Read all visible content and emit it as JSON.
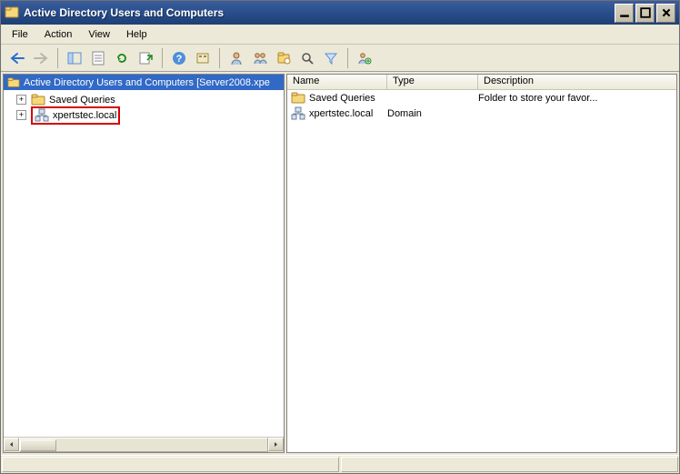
{
  "window": {
    "title": "Active Directory Users and Computers"
  },
  "menubar": {
    "file": "File",
    "action": "Action",
    "view": "View",
    "help": "Help"
  },
  "tree": {
    "root_label": "Active Directory Users and Computers [Server2008.xpe",
    "items": [
      {
        "label": "Saved Queries",
        "icon": "folder"
      },
      {
        "label": "xpertstec.local",
        "icon": "domain",
        "highlight": true
      }
    ]
  },
  "list": {
    "columns": {
      "name": "Name",
      "type": "Type",
      "description": "Description"
    },
    "rows": [
      {
        "name": "Saved Queries",
        "type": "",
        "description": "Folder to store your favor...",
        "icon": "folder"
      },
      {
        "name": "xpertstec.local",
        "type": "Domain",
        "description": "",
        "icon": "domain"
      }
    ]
  }
}
